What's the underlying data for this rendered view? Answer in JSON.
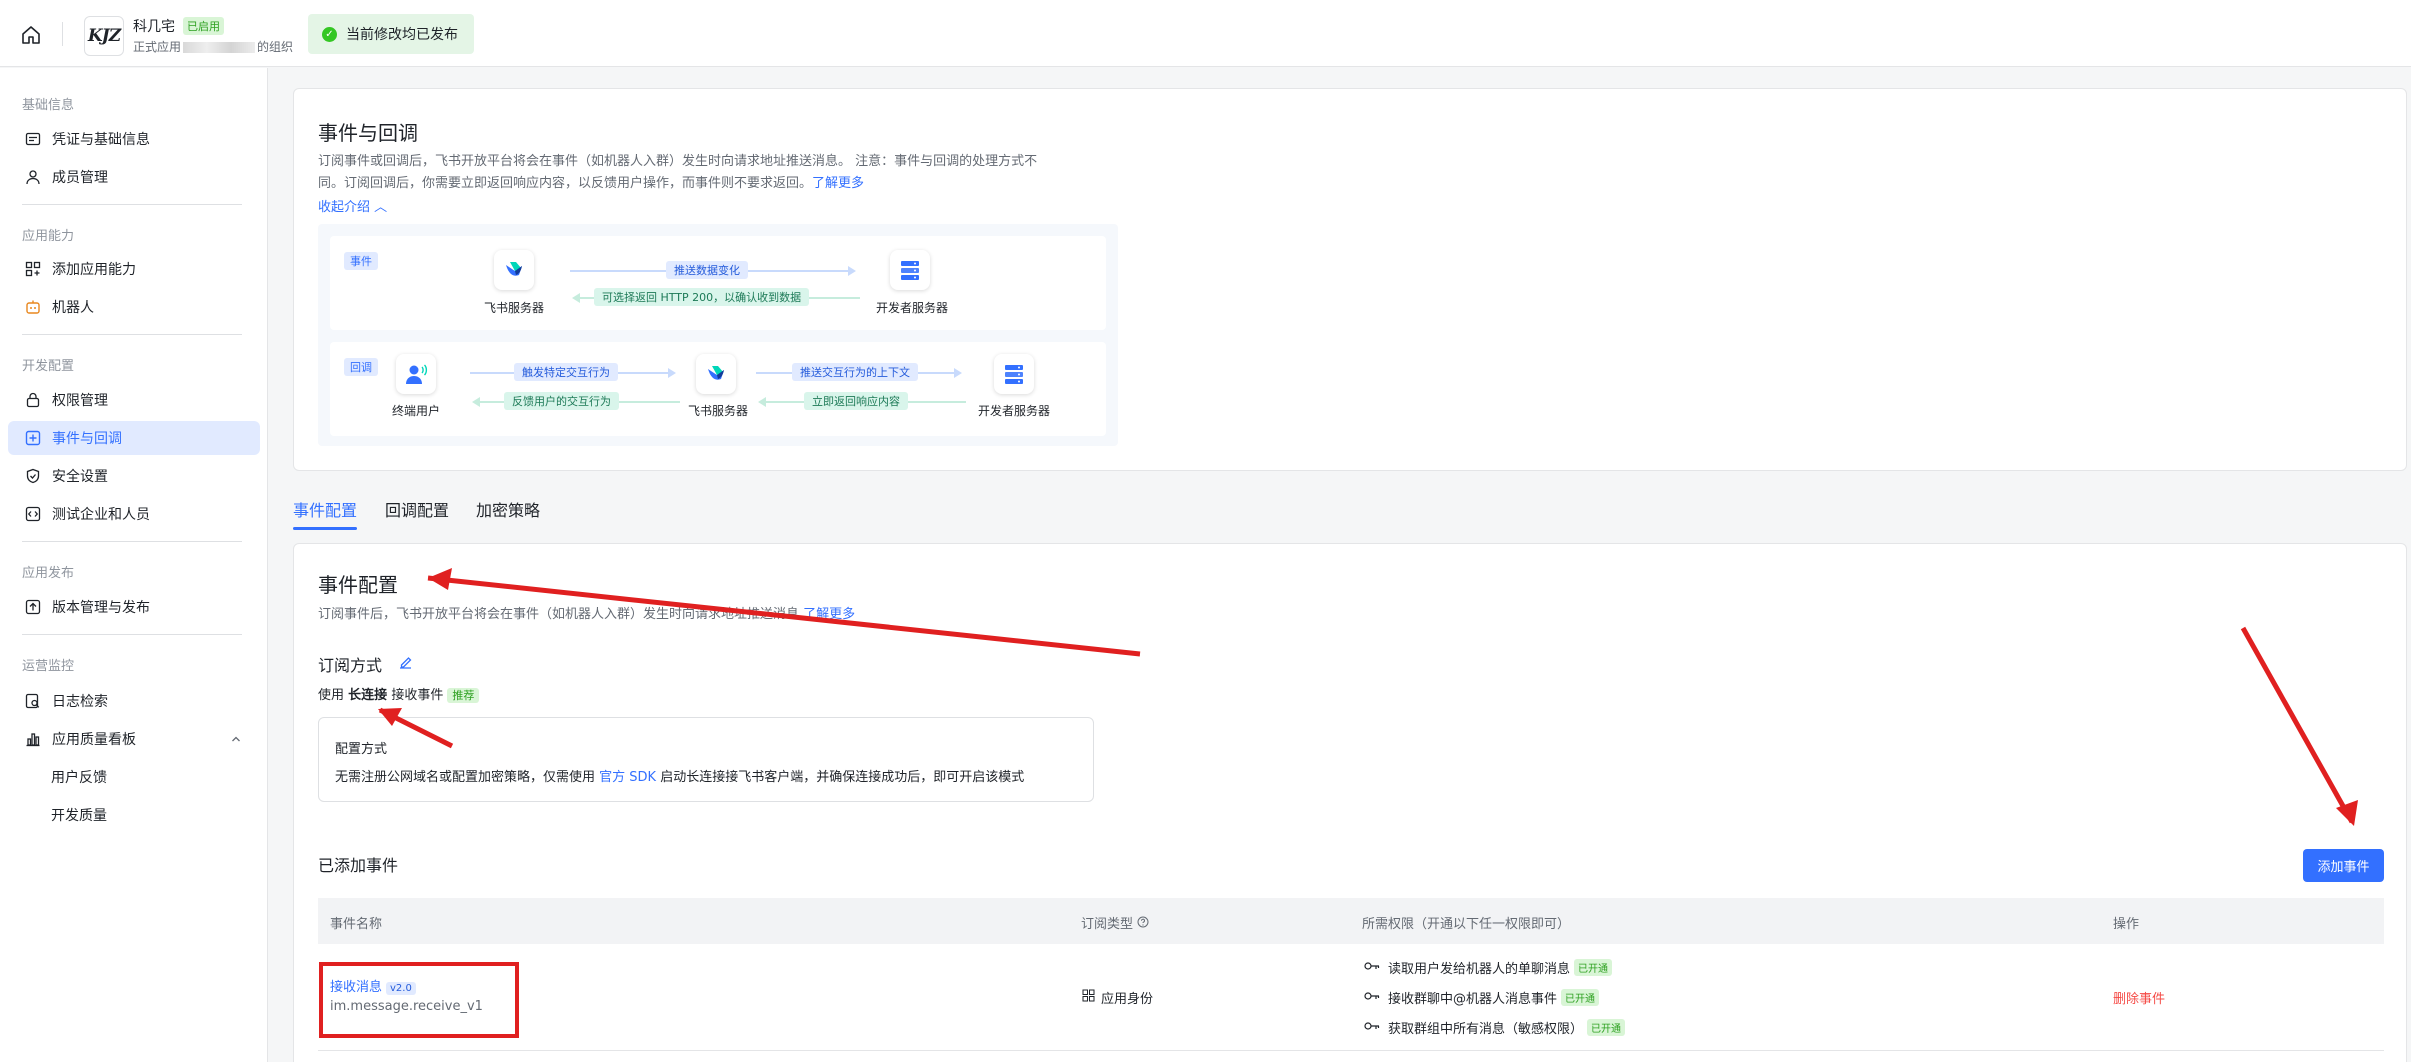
{
  "topbar": {
    "logo": "KJZ",
    "app_name": "科几宅",
    "app_badge": "已启用",
    "app_sub_prefix": "正式应用",
    "app_sub_suffix": "的组织",
    "publish_status": "当前修改均已发布"
  },
  "sidebar": {
    "sections": [
      {
        "title": "基础信息",
        "items": [
          "凭证与基础信息",
          "成员管理"
        ]
      },
      {
        "title": "应用能力",
        "items": [
          "添加应用能力",
          "机器人"
        ]
      },
      {
        "title": "开发配置",
        "items": [
          "权限管理",
          "事件与回调",
          "安全设置",
          "测试企业和人员"
        ]
      },
      {
        "title": "应用发布",
        "items": [
          "版本管理与发布"
        ]
      },
      {
        "title": "运营监控",
        "items": [
          "日志检索",
          "应用质量看板",
          "用户反馈",
          "开发质量"
        ]
      }
    ]
  },
  "intro": {
    "title": "事件与回调",
    "desc_line1": "订阅事件或回调后，飞书开放平台将会在事件（如机器人入群）发生时向请求地址推送消息。 注意：事件与回调的处理方式不",
    "desc_line2": "同。订阅回调后，你需要立即返回响应内容，以反馈用户操作，而事件则不要求返回。",
    "learn_more": "了解更多",
    "collapse": "收起介绍",
    "diagram": {
      "event_tag": "事件",
      "callback_tag": "回调",
      "feishu_server": "飞书服务器",
      "dev_server": "开发者服务器",
      "end_user": "终端用户",
      "e_push": "推送数据变化",
      "e_return": "可选择返回 HTTP 200，以确认收到数据",
      "c_trigger": "触发特定交互行为",
      "c_feedback": "反馈用户的交互行为",
      "c_push": "推送交互行为的上下文",
      "c_return": "立即返回响应内容"
    }
  },
  "tabs": [
    "事件配置",
    "回调配置",
    "加密策略"
  ],
  "event_config": {
    "title": "事件配置",
    "desc": "订阅事件后，飞书开放平台将会在事件（如机器人入群）发生时向请求地址推送消息",
    "learn_more": "了解更多",
    "sub_method_label": "订阅方式",
    "use_prefix": "使用",
    "use_bold": "长连接",
    "use_suffix": "接收事件",
    "recommend": "推荐",
    "config_title": "配置方式",
    "config_desc_prefix": "无需注册公网域名或配置加密策略，仅需使用",
    "config_sdk": "官方 SDK",
    "config_desc_suffix": "启动长连接接飞书客户端，并确保连接成功后，即可开启该模式",
    "added_events": "已添加事件",
    "add_button": "添加事件"
  },
  "table": {
    "headers": [
      "事件名称",
      "订阅类型",
      "所需权限（开通以下任一权限即可）",
      "操作"
    ],
    "rows": [
      {
        "name": "接收消息",
        "version": "v2.0",
        "code": "im.message.receive_v1",
        "type": "应用身份",
        "permissions": [
          {
            "name": "读取用户发给机器人的单聊消息",
            "status": "已开通"
          },
          {
            "name": "接收群聊中@机器人消息事件",
            "status": "已开通"
          },
          {
            "name": "获取群组中所有消息（敏感权限）",
            "status": "已开通"
          }
        ],
        "action": "删除事件"
      }
    ]
  },
  "colors": {
    "accent": "#3370ff",
    "danger": "#f54a45",
    "success": "#34c724",
    "annotation": "#e02020"
  }
}
